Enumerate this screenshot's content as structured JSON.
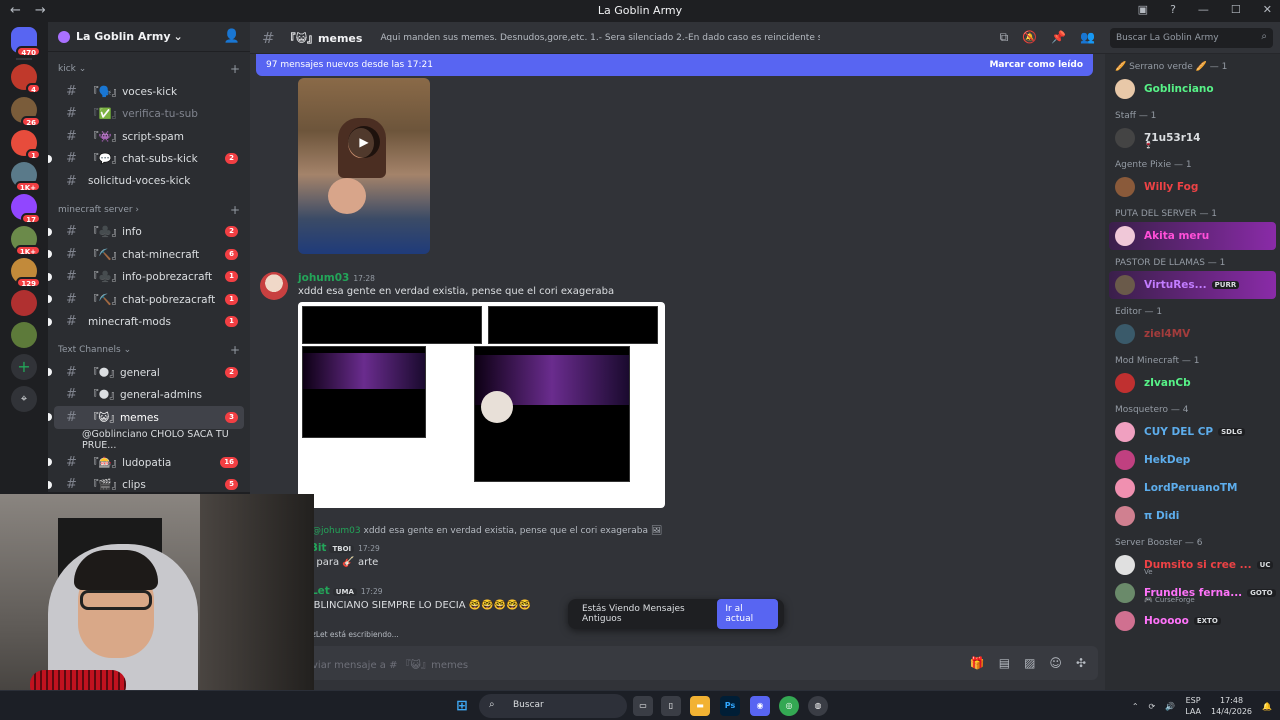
{
  "window": {
    "title": "La Goblin Army"
  },
  "guilds": [
    {
      "badge": "470",
      "color": "#5865f2"
    },
    {
      "badge": "4",
      "color": "#c0392b"
    },
    {
      "badge": "26",
      "color": "#7a5c3a"
    },
    {
      "badge": "1",
      "color": "#e74c3c"
    },
    {
      "badge": "1K+",
      "color": "#5a7a8a"
    },
    {
      "badge": "17",
      "color": "#9146ff"
    },
    {
      "badge": "1K+",
      "color": "#6b8a4a"
    },
    {
      "badge": "129",
      "color": "#c28a3a"
    },
    {
      "badge": "",
      "color": "#b03030"
    },
    {
      "badge": "",
      "color": "#5d7a3a"
    }
  ],
  "server": {
    "name": "La Goblin Army"
  },
  "categories": {
    "kick": "kick",
    "minecraft": "minecraft server",
    "text": "Text Channels"
  },
  "channels": {
    "kick": [
      {
        "name": "『🗣️』voces-kick",
        "count": "",
        "muted": false
      },
      {
        "name": "『✅』verifica-tu-sub",
        "count": "",
        "muted": true
      },
      {
        "name": "『👾』script-spam",
        "count": "",
        "muted": false
      },
      {
        "name": "『💬』chat-subs-kick",
        "count": "2",
        "muted": false
      },
      {
        "name": "solicitud-voces-kick",
        "count": "",
        "muted": false
      }
    ],
    "minecraft": [
      {
        "name": "『♣️』info",
        "count": "2"
      },
      {
        "name": "『⛏️』chat-minecraft",
        "count": "6"
      },
      {
        "name": "『♣️』info-pobrezacraft",
        "count": "1"
      },
      {
        "name": "『⛏️』chat-pobrezacraft",
        "count": "1"
      },
      {
        "name": "minecraft-mods",
        "count": "1"
      }
    ],
    "text": [
      {
        "name": "『🌑』general",
        "count": "2"
      },
      {
        "name": "『🌑』general-admins",
        "count": ""
      },
      {
        "name": "『😺』memes",
        "count": "3"
      },
      {
        "name": "@Goblinciano CHOLO SACA TU PRUE...",
        "count": ""
      },
      {
        "name": "『🎰』ludopatia",
        "count": "16"
      },
      {
        "name": "『🎬』clips",
        "count": "5"
      }
    ]
  },
  "header": {
    "channel": "『😺』memes",
    "topic": "Aqui manden sus memes. Desnudos,gore,etc. 1.- Sera silenciado 2.-En dado caso es reincidente sera baneado",
    "search_placeholder": "Buscar La Goblin Army"
  },
  "newbar": {
    "text": "97 mensajes nuevos desde las 17:21",
    "mark": "Marcar como leído"
  },
  "messages": [
    {
      "user": "johum03",
      "time": "17:28",
      "text": "xddd esa gente en verdad existia, pense que el cori exageraba",
      "color": "#23a559"
    },
    {
      "reply_user": "@johum03",
      "reply_text": "xddd esa gente en verdad existia, pense que el cori exageraba",
      "user": "u-Bit",
      "tag": "TBOI",
      "time": "17:29",
      "text": "iga para 🎸 arte",
      "color": "#23a559"
    },
    {
      "user": "yzLet",
      "tag": "UMA",
      "time": "17:29",
      "text": "GOBLINCIANO SIEMPRE LO DECIA 🤓🤓🤓🤓🤓",
      "color": "#23a559"
    }
  ],
  "typing": "zLet está escribiendo...",
  "old_pill": {
    "text": "Estás Viendo Mensajes Antiguos",
    "button": "Ir al actual"
  },
  "composer": {
    "placeholder": "viar mensaje a # 『😺』memes"
  },
  "members": [
    {
      "role": "🥖 Serrano verde 🥖 — 1",
      "users": [
        {
          "name": "Goblinciano",
          "color": "#57f287"
        }
      ]
    },
    {
      "role": "Staff — 1",
      "users": [
        {
          "name": "71u53r14",
          "color": "#dbdee1",
          "sub": "🍷"
        }
      ]
    },
    {
      "role": "Agente Pixie — 1",
      "users": [
        {
          "name": "Willy Fog",
          "color": "#ed4245"
        }
      ]
    },
    {
      "role": "PUTA DEL SERVER — 1",
      "users": [
        {
          "name": "Akita meru",
          "color": "#ff4fd8",
          "boost": true
        }
      ]
    },
    {
      "role": "PASTOR DE LLAMAS — 1",
      "users": [
        {
          "name": "VirtuRes...",
          "color": "#c27cff",
          "tag": "PURR",
          "boost": true
        }
      ]
    },
    {
      "role": "Editor — 1",
      "users": [
        {
          "name": "ziel4MV",
          "color": "#a33c3c"
        }
      ]
    },
    {
      "role": "Mod Minecraft — 1",
      "users": [
        {
          "name": "zIvanCb",
          "color": "#57f287"
        }
      ]
    },
    {
      "role": "Mosquetero — 4",
      "users": [
        {
          "name": "CUY DEL CP",
          "color": "#5dadec",
          "tag": "SDLG"
        },
        {
          "name": "HekDep",
          "color": "#5dadec"
        },
        {
          "name": "LordPeruanoTM",
          "color": "#5dadec"
        },
        {
          "name": "π Didi",
          "color": "#5dadec"
        }
      ]
    },
    {
      "role": "Server Booster — 6",
      "users": [
        {
          "name": "Dumsito si cree ...",
          "color": "#ed4245",
          "tag": "UC",
          "sub": "Ve"
        },
        {
          "name": "Frundles ferna...",
          "color": "#ff73fa",
          "tag": "GOTO",
          "sub": "🎮 CurseForge"
        },
        {
          "name": "Hooooo",
          "color": "#ff73fa",
          "tag": "EXTO"
        }
      ]
    }
  ],
  "taskbar": {
    "search": "Buscar",
    "lang1": "ESP",
    "lang2": "LAA",
    "time": "17:48",
    "date": "14/4/2026"
  }
}
